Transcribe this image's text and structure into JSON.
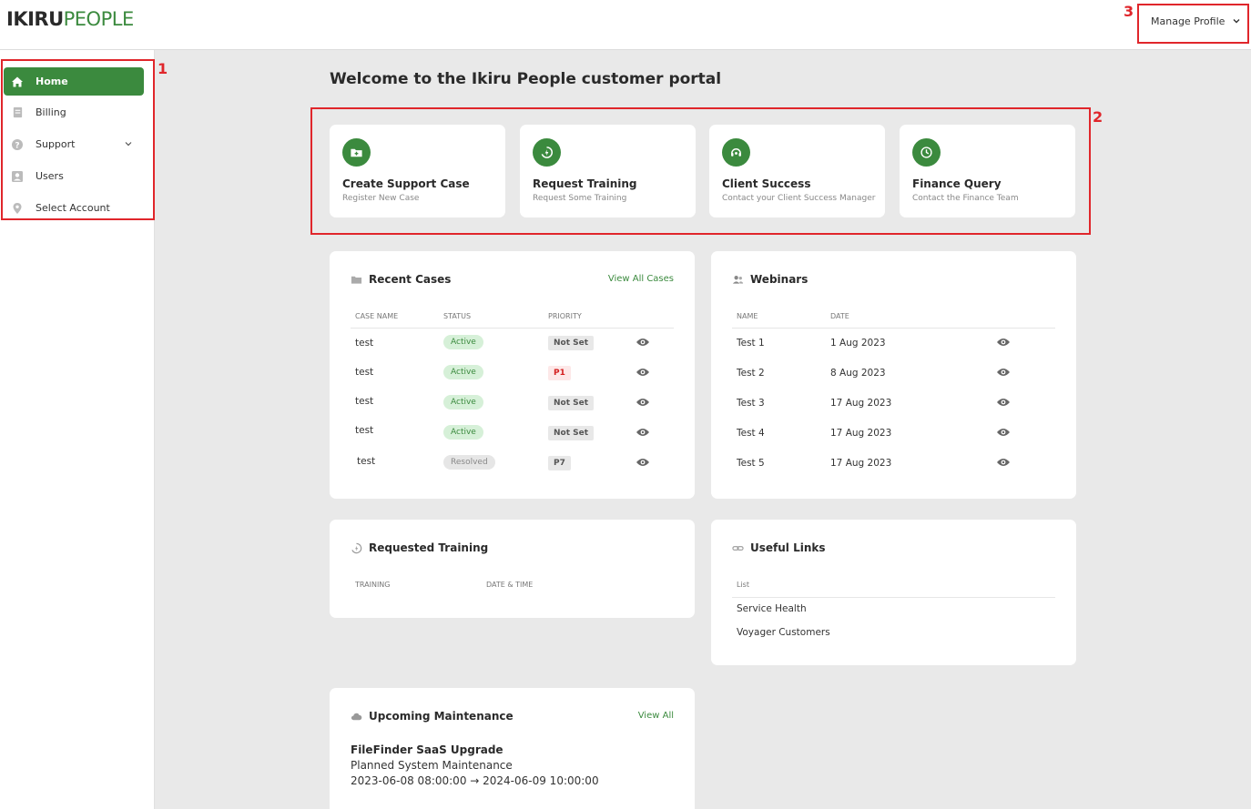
{
  "brand": {
    "logo_part1": "IKIRU",
    "logo_part2": "PEOPLE"
  },
  "header": {
    "manage_profile": "Manage Profile"
  },
  "annotations": [
    "1",
    "2",
    "3"
  ],
  "sidebar": {
    "items": [
      {
        "label": "Home",
        "icon": "home-icon",
        "active": true
      },
      {
        "label": "Billing",
        "icon": "billing-icon"
      },
      {
        "label": "Support",
        "icon": "support-icon",
        "has_submenu": true
      },
      {
        "label": "Users",
        "icon": "users-icon"
      },
      {
        "label": "Select Account",
        "icon": "location-pin-icon"
      }
    ]
  },
  "main": {
    "title": "Welcome to the Ikiru People customer portal",
    "quick_actions": [
      {
        "title": "Create Support Case",
        "subtitle": "Register New Case",
        "icon": "add-folder-icon"
      },
      {
        "title": "Request Training",
        "subtitle": "Request Some Training",
        "icon": "training-icon"
      },
      {
        "title": "Client Success",
        "subtitle": "Contact your Client Success Manager",
        "icon": "headset-icon"
      },
      {
        "title": "Finance Query",
        "subtitle": "Contact the Finance Team",
        "icon": "clock-icon"
      }
    ],
    "recent_cases": {
      "title": "Recent Cases",
      "view_all": "View All Cases",
      "columns": [
        "CASE NAME",
        "STATUS",
        "PRIORITY"
      ],
      "rows": [
        {
          "name": "test",
          "status": "Active",
          "priority": "Not Set"
        },
        {
          "name": "test",
          "status": "Active",
          "priority": "P1"
        },
        {
          "name": "test",
          "status": "Active",
          "priority": "Not Set"
        },
        {
          "name": "test",
          "status": "Active",
          "priority": "Not Set"
        },
        {
          "name": "test",
          "status": "Resolved",
          "priority": "P7"
        }
      ]
    },
    "webinars": {
      "title": "Webinars",
      "columns": [
        "NAME",
        "DATE"
      ],
      "rows": [
        {
          "name": "Test 1",
          "date": "1 Aug 2023"
        },
        {
          "name": "Test 2",
          "date": "8 Aug 2023"
        },
        {
          "name": "Test 3",
          "date": "17 Aug 2023"
        },
        {
          "name": "Test 4",
          "date": "17 Aug 2023"
        },
        {
          "name": "Test 5",
          "date": "17 Aug 2023"
        }
      ]
    },
    "requested_training": {
      "title": "Requested Training",
      "columns": [
        "TRAINING",
        "DATE & TIME"
      ]
    },
    "useful_links": {
      "title": "Useful Links",
      "list_header": "List",
      "links": [
        "Service Health",
        "Voyager Customers"
      ]
    },
    "maintenance": {
      "title": "Upcoming Maintenance",
      "view_all": "View All",
      "item_title": "FileFinder SaaS Upgrade",
      "item_subtitle": "Planned System Maintenance",
      "item_range": "2023-06-08 08:00:00 → 2024-06-09 10:00:00"
    }
  },
  "colors": {
    "accent": "#3b8a3e",
    "annotation": "#e0262b"
  }
}
